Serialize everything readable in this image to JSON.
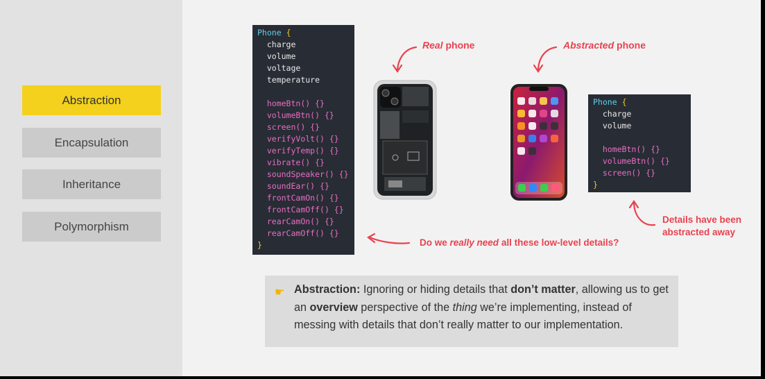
{
  "sidebar": {
    "items": [
      {
        "label": "Abstraction",
        "active": true
      },
      {
        "label": "Encapsulation",
        "active": false
      },
      {
        "label": "Inheritance",
        "active": false
      },
      {
        "label": "Polymorphism",
        "active": false
      }
    ]
  },
  "code_full": {
    "name": "Phone",
    "props": [
      "charge",
      "volume",
      "voltage",
      "temperature"
    ],
    "methods": [
      "homeBtn()",
      "volumeBtn()",
      "screen()",
      "verifyVolt()",
      "verifyTemp()",
      "vibrate()",
      "soundSpeaker()",
      "soundEar()",
      "frontCamOn()",
      "frontCamOff()",
      "rearCamOn()",
      "rearCamOff()"
    ]
  },
  "code_abstract": {
    "name": "Phone",
    "props": [
      "charge",
      "volume"
    ],
    "methods": [
      "homeBtn()",
      "volumeBtn()",
      "screen()"
    ]
  },
  "annotations": {
    "real_em": "Real",
    "real_rest": " phone",
    "abstracted_em": "Abstracted",
    "abstracted_rest": " phone",
    "question_pre": "Do we ",
    "question_em": "really need",
    "question_post": " all these low-level details?",
    "details_line1": "Details have been",
    "details_line2": "abstracted away"
  },
  "callout": {
    "term": "Abstraction:",
    "t1": " Ignoring or hiding details that ",
    "b1": "don’t matter",
    "t2": ", allowing us to get an ",
    "b2": "overview",
    "t3": " perspective of the ",
    "i1": "thing",
    "t4": " we’re implementing, instead of messing with details that don’t really matter to our implementation."
  },
  "colors": {
    "accent": "#f3d11c",
    "annotation": "#e8424f",
    "code_bg": "#282c35"
  },
  "icons": {
    "callout": "pointing-hand-icon"
  }
}
